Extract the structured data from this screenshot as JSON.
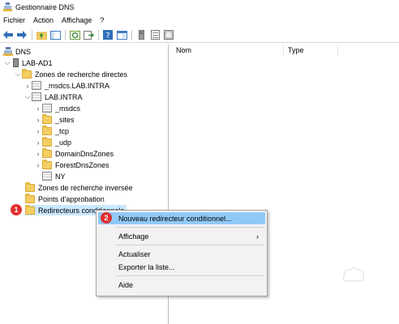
{
  "window": {
    "title": "Gestionnaire DNS"
  },
  "menu": [
    "Fichier",
    "Action",
    "Affichage",
    "?"
  ],
  "tree": {
    "root": "DNS",
    "server": "LAB-AD1",
    "forward_zones": "Zones de recherche directes",
    "msdcs_zone": "_msdcs.LAB.INTRA",
    "lab_zone": "LAB.INTRA",
    "children": [
      "_msdcs",
      "_sites",
      "_tcp",
      "_udp",
      "DomainDnsZones",
      "ForestDnsZones",
      "NY"
    ],
    "reverse_zones": "Zones de recherche inversée",
    "trust_points": "Points d'approbation",
    "conditional_forwarders": "Redirecteurs conditionnels"
  },
  "list": {
    "col_name": "Nom",
    "col_type": "Type"
  },
  "context_menu": {
    "new_forwarder": "Nouveau redirecteur conditionnel...",
    "view": "Affichage",
    "refresh": "Actualiser",
    "export": "Exporter la liste...",
    "help": "Aide"
  },
  "badges": {
    "step1": "1",
    "step2": "2"
  },
  "colors": {
    "highlight": "#91c9f7",
    "badge": "#e03030",
    "folder": "#f3ce63"
  }
}
